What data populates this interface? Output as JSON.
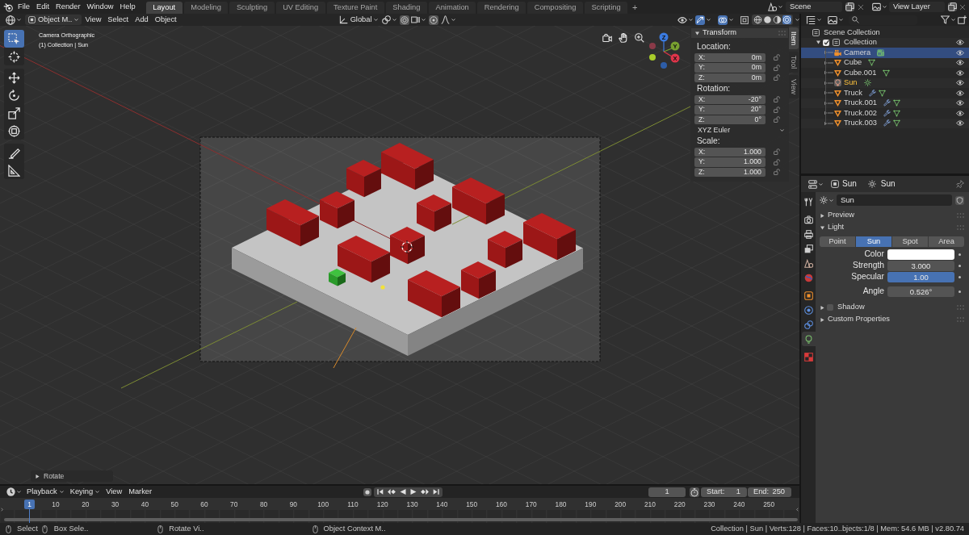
{
  "top_bar": {
    "menus": [
      "File",
      "Edit",
      "Render",
      "Window",
      "Help"
    ],
    "workspaces": [
      {
        "label": "Layout",
        "selected": true
      },
      {
        "label": "Modeling",
        "selected": false
      },
      {
        "label": "Sculpting",
        "selected": false
      },
      {
        "label": "UV Editing",
        "selected": false
      },
      {
        "label": "Texture Paint",
        "selected": false
      },
      {
        "label": "Shading",
        "selected": false
      },
      {
        "label": "Animation",
        "selected": false
      },
      {
        "label": "Rendering",
        "selected": false
      },
      {
        "label": "Compositing",
        "selected": false
      },
      {
        "label": "Scripting",
        "selected": false
      }
    ],
    "add_workspace": "+",
    "scene": "Scene",
    "view_layer": "View Layer"
  },
  "viewport_header": {
    "mode": "Object M..",
    "menus": [
      "View",
      "Select",
      "Add",
      "Object"
    ],
    "orientation": "Global",
    "gizmos_on": true,
    "overlays_on": true,
    "xray_on": false,
    "shading_modes": [
      {
        "kind": "wireframe",
        "selected": false
      },
      {
        "kind": "solid",
        "selected": false
      },
      {
        "kind": "material",
        "selected": false
      },
      {
        "kind": "rendered",
        "selected": true
      }
    ]
  },
  "toolbar": {
    "tools": [
      {
        "kind": "select",
        "selected": true
      },
      {
        "kind": "cursor",
        "selected": false
      },
      {
        "kind": "move",
        "selected": false
      },
      {
        "kind": "rotate",
        "selected": false
      },
      {
        "kind": "scale",
        "selected": false
      },
      {
        "kind": "transform",
        "selected": false
      },
      {
        "kind": "annotate",
        "selected": false
      },
      {
        "kind": "measure",
        "selected": false
      }
    ]
  },
  "viewport": {
    "view_name": "Camera Orthographic",
    "context": "(1) Collection | Sun",
    "gizmo_axes": [
      "X",
      "Y",
      "Z"
    ],
    "last_operator": {
      "label": "Rotate",
      "expanded": false
    }
  },
  "sidebar": {
    "tabs": [
      {
        "label": "Item",
        "selected": true
      },
      {
        "label": "Tool",
        "selected": false
      },
      {
        "label": "View",
        "selected": false
      }
    ],
    "panel": {
      "title": "Transform",
      "expanded": true
    },
    "groups": [
      {
        "label": "Location:",
        "fields": [
          {
            "axis": "X:",
            "value": "0m"
          },
          {
            "axis": "Y:",
            "value": "0m"
          },
          {
            "axis": "Z:",
            "value": "0m"
          }
        ]
      },
      {
        "label": "Rotation:",
        "fields": [
          {
            "axis": "X:",
            "value": "-20°"
          },
          {
            "axis": "Y:",
            "value": "20°"
          },
          {
            "axis": "Z:",
            "value": "0°"
          }
        ],
        "mode": "XYZ Euler"
      },
      {
        "label": "Scale:",
        "fields": [
          {
            "axis": "X:",
            "value": "1.000"
          },
          {
            "axis": "Y:",
            "value": "1.000"
          },
          {
            "axis": "Z:",
            "value": "1.000"
          }
        ]
      }
    ]
  },
  "outliner": {
    "root": "Scene Collection",
    "collection": {
      "name": "Collection",
      "expanded": true,
      "checked": true,
      "children": [
        {
          "name": "Camera",
          "kind": "camera",
          "selected": true,
          "active": false,
          "modifier": false,
          "data_active": true
        },
        {
          "name": "Cube",
          "kind": "mesh",
          "selected": false,
          "active": false,
          "modifier": false,
          "data_active": false
        },
        {
          "name": "Cube.001",
          "kind": "mesh",
          "selected": false,
          "active": false,
          "modifier": false,
          "data_active": false
        },
        {
          "name": "Sun",
          "kind": "light",
          "selected": false,
          "active": true,
          "modifier": false,
          "data_active": false
        },
        {
          "name": "Truck",
          "kind": "mesh",
          "selected": false,
          "active": false,
          "modifier": true,
          "data_active": false
        },
        {
          "name": "Truck.001",
          "kind": "mesh",
          "selected": false,
          "active": false,
          "modifier": true,
          "data_active": false
        },
        {
          "name": "Truck.002",
          "kind": "mesh",
          "selected": false,
          "active": false,
          "modifier": true,
          "data_active": false
        },
        {
          "name": "Truck.003",
          "kind": "mesh",
          "selected": false,
          "active": false,
          "modifier": true,
          "data_active": false
        }
      ]
    }
  },
  "properties": {
    "object": "Sun",
    "data": "Sun",
    "tabs": [
      {
        "kind": "tool",
        "selected": false
      },
      {
        "kind": "render",
        "selected": false
      },
      {
        "kind": "output",
        "selected": false
      },
      {
        "kind": "view_layer",
        "selected": false
      },
      {
        "kind": "scene",
        "selected": false
      },
      {
        "kind": "world",
        "selected": false
      },
      {
        "kind": "object",
        "selected": false
      },
      {
        "kind": "physics",
        "selected": false
      },
      {
        "kind": "constraints",
        "selected": false
      },
      {
        "kind": "data",
        "selected": true
      },
      {
        "kind": "texture",
        "selected": false
      }
    ],
    "datablock": "Sun",
    "panels": [
      {
        "kind": "plain",
        "title": "Preview",
        "expanded": false
      },
      {
        "kind": "light",
        "title": "Light",
        "expanded": true,
        "types": [
          {
            "label": "Point",
            "selected": false
          },
          {
            "label": "Sun",
            "selected": true
          },
          {
            "label": "Spot",
            "selected": false
          },
          {
            "label": "Area",
            "selected": false
          }
        ],
        "rows": [
          {
            "kind": "color",
            "label": "Color",
            "color": "#ffffff"
          },
          {
            "kind": "number",
            "label": "Strength",
            "value": "3.000"
          },
          {
            "kind": "slider",
            "label": "Specular",
            "value": "1.00",
            "level": 1
          },
          {
            "kind": "number",
            "label": "Angle",
            "value": "0.526°"
          }
        ]
      },
      {
        "kind": "toggle",
        "title": "Shadow",
        "expanded": false,
        "checked": false
      },
      {
        "kind": "plain",
        "title": "Custom Properties",
        "expanded": false
      }
    ]
  },
  "timeline": {
    "menus": [
      {
        "label": "Playback",
        "dropdown": true
      },
      {
        "label": "Keying",
        "dropdown": true
      },
      {
        "label": "View",
        "dropdown": false
      },
      {
        "label": "Marker",
        "dropdown": false
      }
    ],
    "current_frame": "1",
    "start": {
      "label": "Start:",
      "value": "1"
    },
    "end": {
      "label": "End:",
      "value": "250"
    },
    "playhead": "1",
    "ruler": [
      "10",
      "20",
      "30",
      "40",
      "50",
      "60",
      "70",
      "80",
      "90",
      "100",
      "110",
      "120",
      "130",
      "140",
      "150",
      "160",
      "170",
      "180",
      "190",
      "200",
      "210",
      "220",
      "230",
      "240",
      "250"
    ]
  },
  "status_bar": {
    "hints": [
      "Select",
      "Box Sele..",
      "Rotate Vi..",
      "Object Context M.."
    ],
    "info": "Collection | Sun | Verts:128 | Faces:10..bjects:1/8 | Mem: 54.6 MB | v2.80.74"
  }
}
